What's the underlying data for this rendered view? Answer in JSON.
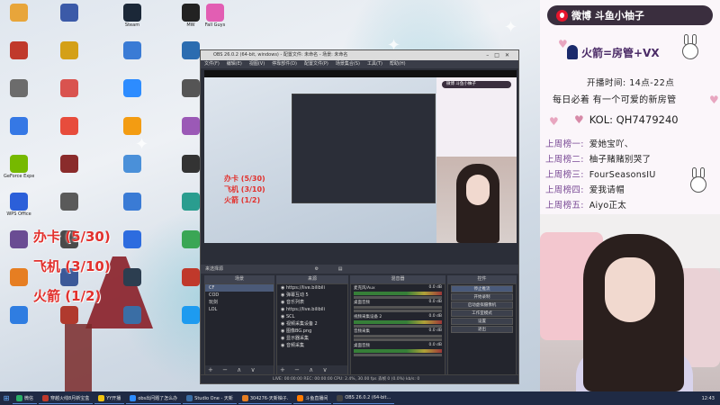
{
  "desktop": {
    "icons": [
      {
        "label": "",
        "color": "#e8a53a"
      },
      {
        "label": "",
        "color": "#3b5aa8"
      },
      {
        "label": "Steam",
        "color": "#1b2838"
      },
      {
        "label": "MW",
        "color": "#222"
      },
      {
        "label": "Fall Guys",
        "color": "#e25eb3"
      },
      {
        "label": "",
        "color": "#c0392b"
      },
      {
        "label": "",
        "color": "#d4a017"
      },
      {
        "label": "",
        "color": "#3a7bd5"
      },
      {
        "label": "",
        "color": "#2b6cb0"
      },
      {
        "label": "",
        "color": "#c89b3c"
      },
      {
        "label": "",
        "color": "#6c6c6c"
      },
      {
        "label": "",
        "color": "#d9534f"
      },
      {
        "label": "",
        "color": "#2d8cff"
      },
      {
        "label": "",
        "color": "#555"
      },
      {
        "label": "",
        "color": "#c89b3c"
      },
      {
        "label": "",
        "color": "#3578e5"
      },
      {
        "label": "",
        "color": "#e74c3c"
      },
      {
        "label": "",
        "color": "#f39c12"
      },
      {
        "label": "",
        "color": "#9b59b6"
      },
      {
        "label": "",
        "color": "#c89b3c"
      },
      {
        "label": "GeForce Experience",
        "color": "#76b900"
      },
      {
        "label": "",
        "color": "#8a2b2b"
      },
      {
        "label": "",
        "color": "#4a90d9"
      },
      {
        "label": "",
        "color": "#333"
      },
      {
        "label": "",
        "color": "#c0392b"
      },
      {
        "label": "WPS Office",
        "color": "#2b5fd9"
      },
      {
        "label": "",
        "color": "#5a5a5a"
      },
      {
        "label": "",
        "color": "#3a7bd5"
      },
      {
        "label": "",
        "color": "#2a9d8f"
      },
      {
        "label": "",
        "color": "#b22222"
      },
      {
        "label": "",
        "color": "#6a4c93"
      },
      {
        "label": "",
        "color": "#4a4a4a"
      },
      {
        "label": "",
        "color": "#2d6cdf"
      },
      {
        "label": "",
        "color": "#3aa655"
      },
      {
        "label": "",
        "color": "#777"
      },
      {
        "label": "",
        "color": "#e67e22"
      },
      {
        "label": "",
        "color": "#3b5998"
      },
      {
        "label": "",
        "color": "#2c3e50"
      },
      {
        "label": "",
        "color": "#c0392b"
      },
      {
        "label": "",
        "color": "#555"
      },
      {
        "label": "",
        "color": "#2f7de1"
      },
      {
        "label": "",
        "color": "#b03a2e"
      },
      {
        "label": "",
        "color": "#3a6ea5"
      },
      {
        "label": "",
        "color": "#1d9bf0"
      },
      {
        "label": "",
        "color": "#444"
      }
    ]
  },
  "overlay": {
    "office_card": "办卡 (5/30)",
    "plane": "飞机 (3/10)",
    "rocket": "火箭 (1/2)"
  },
  "obs": {
    "title": "OBS 26.0.2 (64-bit, windows) - 配置文件: 未命名 - 场景: 未命名",
    "menu": [
      "文件(F)",
      "编辑(E)",
      "视图(V)",
      "停靠部件(D)",
      "配置文件(P)",
      "场景集合(S)",
      "工具(T)",
      "帮助(H)"
    ],
    "docks_bar": "来选择源",
    "dock_headers": {
      "scenes": "场景",
      "sources": "来源",
      "mixer": "混音器",
      "transition": "转场",
      "controls": "控件"
    },
    "scenes": [
      "CF",
      "COD",
      "玩剑",
      "LOL"
    ],
    "sources": [
      "https://live.bilibili",
      "弹幕互动 5",
      "音乐列表",
      "https://live.bilibili",
      "SCL",
      "视频采集设备 2",
      "图像BG.png",
      "显示器采集",
      "音频采集"
    ],
    "mixer": [
      {
        "name": "麦克风/Aux",
        "db": "0.0 dB"
      },
      {
        "name": "桌面音频",
        "db": "0.0 dB"
      },
      {
        "name": "视频采集设备 2",
        "db": "0.0 dB"
      },
      {
        "name": "音频采集",
        "db": "0.0 dB"
      },
      {
        "name": "桌面音频",
        "db": "0.0 dB"
      }
    ],
    "controls": [
      "停止推流",
      "开始录制",
      "启动虚拟摄像机",
      "工作室模式",
      "设置",
      "退出"
    ],
    "status": "LIVE: 00:00:00   REC: 00:00:00   CPU: 2.4%, 30.00 fps   丢帧 0 (0.0%)   kb/s: 0",
    "dock_foot": "+ − ∧ ∨"
  },
  "panel": {
    "weibo": "微博 斗鱼小柚子",
    "rocket_line": "火箭=房管+VX",
    "time": "开播时间: 14点-22点",
    "daily": "每日必着 有一个可爱的新房管",
    "kol": "KOL: QH7479240",
    "boards": [
      {
        "rank": "上周榜一:",
        "name": "爱她宝吖、"
      },
      {
        "rank": "上周榜二:",
        "name": "柚子赌赌别哭了"
      },
      {
        "rank": "上周榜三:",
        "name": "FourSeasonsIU"
      },
      {
        "rank": "上周榜四:",
        "name": "爱我请帽"
      },
      {
        "rank": "上周榜五:",
        "name": "Aiyo正太"
      }
    ]
  },
  "taskbar": {
    "items": [
      {
        "label": "微信",
        "color": "#2aae67"
      },
      {
        "label": "穿越火线8月新宝盒",
        "color": "#c0392b"
      },
      {
        "label": "YY开播",
        "color": "#f1c40f"
      },
      {
        "label": "obs出问题了怎么办",
        "color": "#2d8cff"
      },
      {
        "label": "Studio One - 天新",
        "color": "#3a6ea5"
      },
      {
        "label": "304276-天新柚子.",
        "color": "#e67e22"
      },
      {
        "label": "斗鱼直播间",
        "color": "#ff7a00"
      },
      {
        "label": "OBS 26.0.2 (64-bit...",
        "color": "#444"
      }
    ],
    "clock": "12:43"
  }
}
